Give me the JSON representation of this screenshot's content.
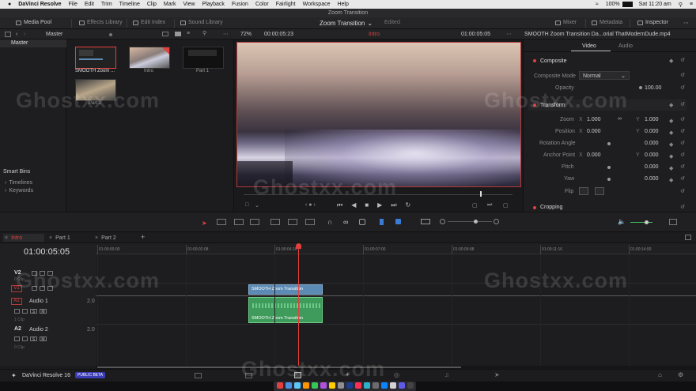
{
  "menubar": {
    "app": "DaVinci Resolve",
    "items": [
      "File",
      "Edit",
      "Trim",
      "Timeline",
      "Clip",
      "Mark",
      "View",
      "Playback",
      "Fusion",
      "Color",
      "Fairlight",
      "Workspace",
      "Help"
    ],
    "battery": "100%",
    "clock": "Sat 11:20 am"
  },
  "window": {
    "title": "Zoom Transition"
  },
  "toolbar": {
    "media_pool": "Media Pool",
    "effects_library": "Effects Library",
    "edit_index": "Edit Index",
    "sound_library": "Sound Library",
    "project_title": "Zoom Transition",
    "project_status": "Edited",
    "mixer": "Mixer",
    "metadata": "Metadata",
    "inspector": "Inspector"
  },
  "subbar": {
    "bin_path": "Master",
    "zoom": "72%",
    "source_timecode": "00:00:05:23",
    "timeline_name": "Intro",
    "record_timecode": "01:00:05:05",
    "clip_name": "SMOOTH Zoom Transition Da...orial  ThatModernDude.mp4"
  },
  "media_pool": {
    "bins": [
      "Master"
    ],
    "clips": [
      {
        "name": "SMOOTH Zoom ...",
        "selected": true
      },
      {
        "name": "Intro",
        "selected": false
      },
      {
        "name": "Part 1",
        "selected": false
      },
      {
        "name": "Part 2",
        "selected": false
      }
    ],
    "smart_bins_title": "Smart Bins",
    "smart_bins": [
      "Timelines",
      "Keywords"
    ]
  },
  "inspector": {
    "tabs": [
      "Video",
      "Audio"
    ],
    "active_tab": "Video",
    "composite": {
      "title": "Composite",
      "mode_label": "Composite Mode",
      "mode_value": "Normal",
      "opacity_label": "Opacity",
      "opacity_value": "100.00"
    },
    "transform": {
      "title": "Transform",
      "zoom_label": "Zoom",
      "zoom_x": "1.000",
      "zoom_y": "1.000",
      "position_label": "Position",
      "position_x": "0.000",
      "position_y": "0.000",
      "rotation_label": "Rotation Angle",
      "rotation_value": "0.000",
      "anchor_label": "Anchor Point",
      "anchor_x": "0.000",
      "anchor_y": "0.000",
      "pitch_label": "Pitch",
      "pitch_value": "0.000",
      "yaw_label": "Yaw",
      "yaw_value": "0.000",
      "flip_label": "Flip",
      "x_axis": "X",
      "y_axis": "Y"
    },
    "cropping": {
      "title": "Cropping"
    }
  },
  "timeline": {
    "tabs": [
      "Intro",
      "Part 1",
      "Part 2"
    ],
    "active_tab": "Intro",
    "current_timecode": "01:00:05:05",
    "ruler": [
      "01:00:00:00",
      "01:00:02:08",
      "01:00:04:16",
      "01:00:07:00",
      "01:00:09:08",
      "01:00:11:16",
      "01:00:14:00"
    ],
    "playhead_fraction": 0.337,
    "tracks": [
      {
        "id": "V2",
        "name": "",
        "clips": "0 Clip"
      },
      {
        "id": "V1",
        "name": "",
        "clips": ""
      },
      {
        "id": "A1",
        "name": "Audio 1",
        "level": "2.0",
        "clips": "1 Clip"
      },
      {
        "id": "A2",
        "name": "Audio 2",
        "level": "2.0",
        "clips": "0 Clip"
      }
    ],
    "video_clip_label": "SMOOTH Zoom Transition",
    "audio_clip_label": "SMOOTH Zoom Transition"
  },
  "bottom": {
    "app_name": "DaVinci Resolve 16",
    "badge": "PUBLIC BETA"
  },
  "watermark": "Ghostxx.com",
  "colors": {
    "accent_red": "#e2403e",
    "video_clip": "#5b8bb5",
    "audio_clip": "#3f9b5c",
    "playhead": "#e2403e"
  }
}
